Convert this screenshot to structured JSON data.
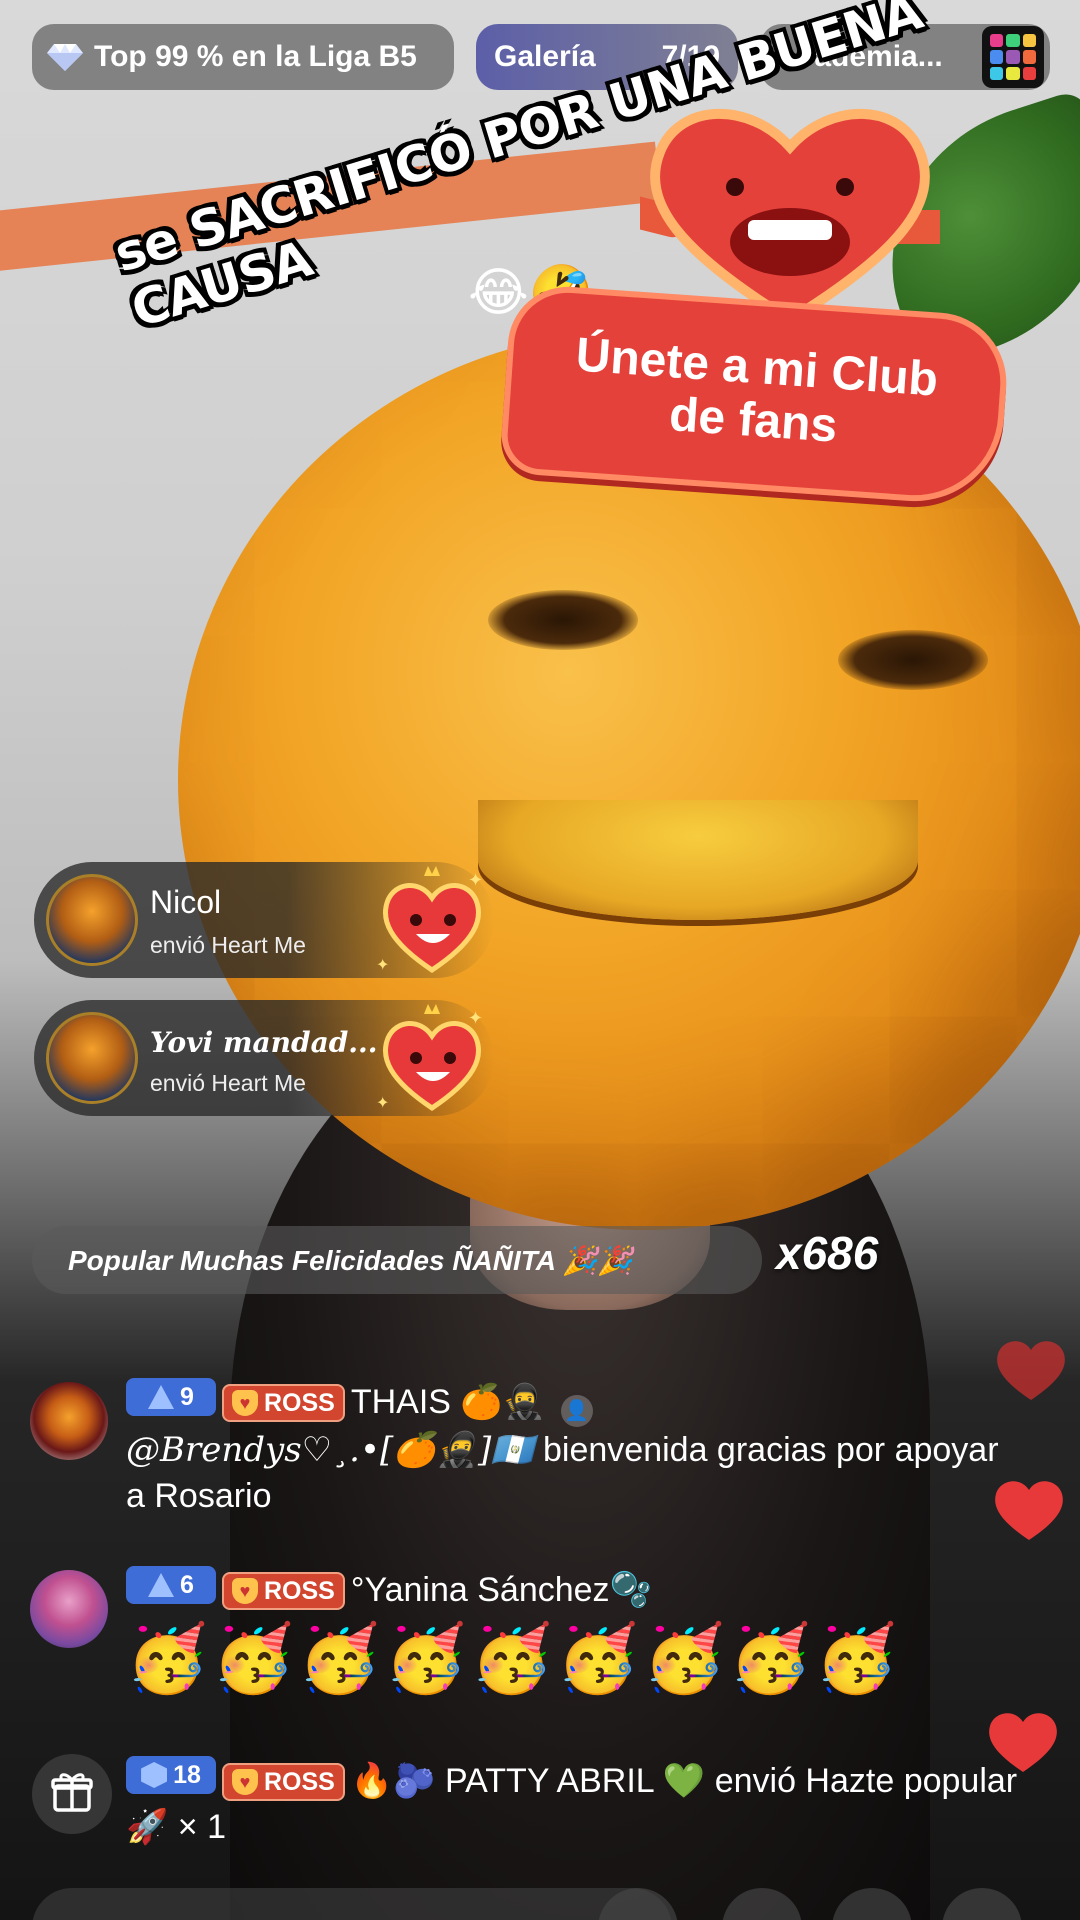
{
  "top_bar": {
    "league": {
      "icon": "diamond-icon",
      "label": "Top 99 % en la Liga B5"
    },
    "gallery": {
      "label": "Galería",
      "count": "7/19"
    },
    "academy": {
      "label": "Academia...",
      "thumbnail": "academy-thumbnail"
    }
  },
  "overlay": {
    "sticker_text": "se SACRIFICÓ POR UNA BUENA CAUSA",
    "sticker_emoji": "😂🤣",
    "fan_club_button": "Únete a mi Club de fans"
  },
  "gift_notifications": [
    {
      "user": "Nicol",
      "action": "envió Heart Me",
      "gift_icon": "heart-me-icon"
    },
    {
      "user": "Yovi mandad...",
      "action": "envió Heart Me",
      "gift_icon": "heart-me-icon"
    }
  ],
  "popular_banner": {
    "text": "Popular Muchas Felicidades ÑAÑITA 🎉🎉",
    "multiplier": "x686"
  },
  "chat": [
    {
      "level": "9",
      "level_icon": "triangle-level-icon",
      "club": "ROSS",
      "user": "THAIS 🍊🥷",
      "user_suffix_icon": "person-icon",
      "mention": "@Brendys♡¸.•[🍊🥷]🇬🇹",
      "message": " bienvenida gracias por apoyar a Rosario"
    },
    {
      "level": "6",
      "level_icon": "triangle-level-icon",
      "club": "ROSS",
      "user": "°Yanina Sánchez🫧",
      "message": "🥳🥳🥳🥳🥳🥳🥳🥳🥳"
    },
    {
      "level": "18",
      "level_icon": "hexagon-level-icon",
      "club": "ROSS",
      "user": "🔥🫐 PATTY ABRIL 💚",
      "message": " envió Hazte popular 🚀 × 1"
    }
  ],
  "colors": {
    "club_badge": "#d2452f",
    "level_badge": "#3f6dd7",
    "fan_club": "#e4413b",
    "heart": "#e8393a"
  }
}
